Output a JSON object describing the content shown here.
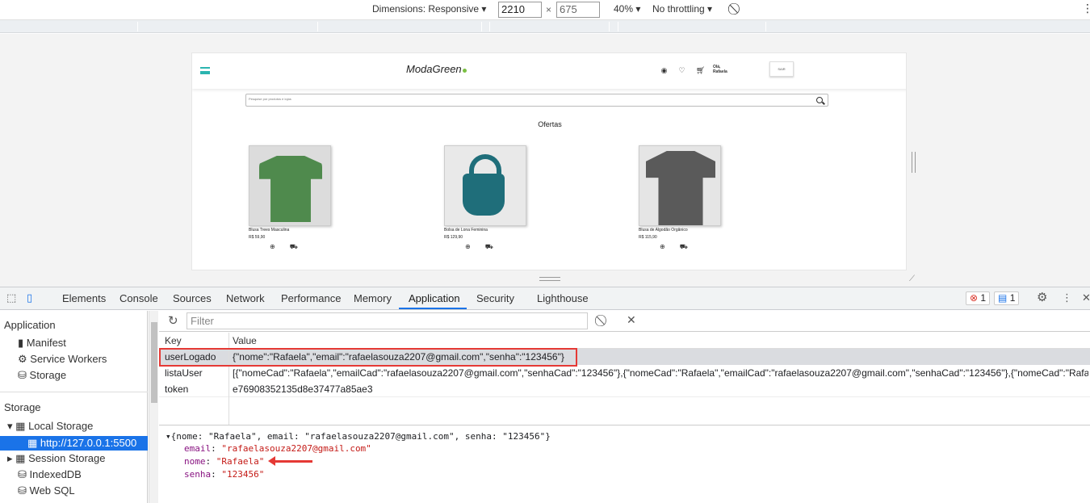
{
  "device_toolbar": {
    "dimensions_label": "Dimensions: Responsive",
    "width": "2210",
    "height": "675",
    "times": "×",
    "zoom": "40%",
    "throttling": "No throttling"
  },
  "site": {
    "logo": "ModaGreen",
    "greeting": "Olá,",
    "user": "Rafaela",
    "logout": "SAIR",
    "search_placeholder": "Pesquise por produtos e lojas",
    "section_title": "Ofertas",
    "products": [
      {
        "name": "Blusa Trees Masculina",
        "price": "R$ 59,90"
      },
      {
        "name": "Bolsa de Lona Feminina",
        "price": "R$ 129,90"
      },
      {
        "name": "Blusa de Algodão Orgânico",
        "price": "R$ 115,90"
      }
    ]
  },
  "devtools": {
    "tabs": [
      "Elements",
      "Console",
      "Sources",
      "Network",
      "Performance",
      "Memory",
      "Application",
      "Security",
      "Lighthouse"
    ],
    "active_tab": "Application",
    "errors": "1",
    "messages": "1",
    "sidebar": {
      "application_header": "Application",
      "manifest": "Manifest",
      "service_workers": "Service Workers",
      "storage_item": "Storage",
      "storage_header": "Storage",
      "local_storage": "Local Storage",
      "local_origin": "http://127.0.0.1:5500",
      "session_storage": "Session Storage",
      "indexeddb": "IndexedDB",
      "websql": "Web SQL"
    },
    "filter_placeholder": "Filter",
    "table": {
      "key_header": "Key",
      "value_header": "Value",
      "rows": [
        {
          "key": "userLogado",
          "value": "{\"nome\":\"Rafaela\",\"email\":\"rafaelasouza2207@gmail.com\",\"senha\":\"123456\"}"
        },
        {
          "key": "listaUser",
          "value": "[{\"nomeCad\":\"Rafaela\",\"emailCad\":\"rafaelasouza2207@gmail.com\",\"senhaCad\":\"123456\"},{\"nomeCad\":\"Rafaela\",\"emailCad\":\"rafaelasouza2207@gmail.com\",\"senhaCad\":\"123456\"},{\"nomeCad\":\"Rafaela..."
        },
        {
          "key": "token",
          "value": "e76908352135d8e37477a85ae3"
        }
      ]
    },
    "preview": {
      "summary": "{nome: \"Rafaela\", email: \"rafaelasouza2207@gmail.com\", senha: \"123456\"}",
      "email_key": "email",
      "email_val": "\"rafaelasouza2207@gmail.com\"",
      "nome_key": "nome",
      "nome_val": "\"Rafaela\"",
      "senha_key": "senha",
      "senha_val": "\"123456\""
    }
  }
}
